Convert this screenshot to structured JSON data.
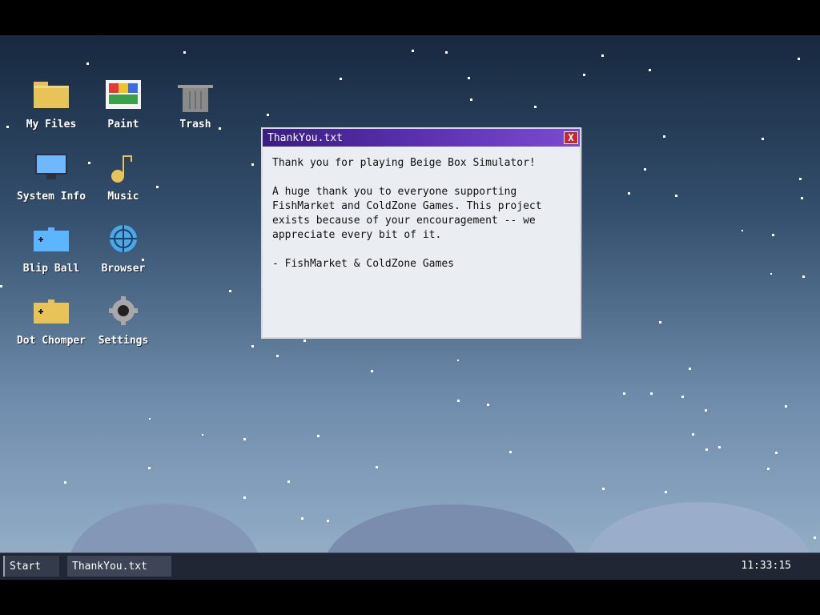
{
  "desktop": {
    "icons": [
      {
        "label": "My Files",
        "icon": "folder-icon"
      },
      {
        "label": "Paint",
        "icon": "paint-icon"
      },
      {
        "label": "Trash",
        "icon": "trash-icon"
      },
      {
        "label": "System Info",
        "icon": "monitor-icon"
      },
      {
        "label": "Music",
        "icon": "music-note-icon"
      },
      {
        "label": "Blip Ball",
        "icon": "game-box-icon"
      },
      {
        "label": "Browser",
        "icon": "crosshair-globe-icon"
      },
      {
        "label": "Dot Chomper",
        "icon": "game-box-icon"
      },
      {
        "label": "Settings",
        "icon": "gear-icon"
      }
    ]
  },
  "window": {
    "title": "ThankYou.txt",
    "close_label": "X",
    "body": {
      "line1": "Thank you for playing Beige Box Simulator!",
      "para2": "A huge thank you to everyone supporting FishMarket and ColdZone Games. This project exists because of your encouragement -- we appreciate every bit of it.",
      "signature": "- FishMarket & ColdZone Games"
    }
  },
  "taskbar": {
    "start_label": "Start",
    "open_window_label": "ThankYou.txt",
    "clock": "11:33:15"
  },
  "colors": {
    "titlebar": "#5b31b0",
    "close": "#c8282d",
    "taskbar": "#202634"
  }
}
